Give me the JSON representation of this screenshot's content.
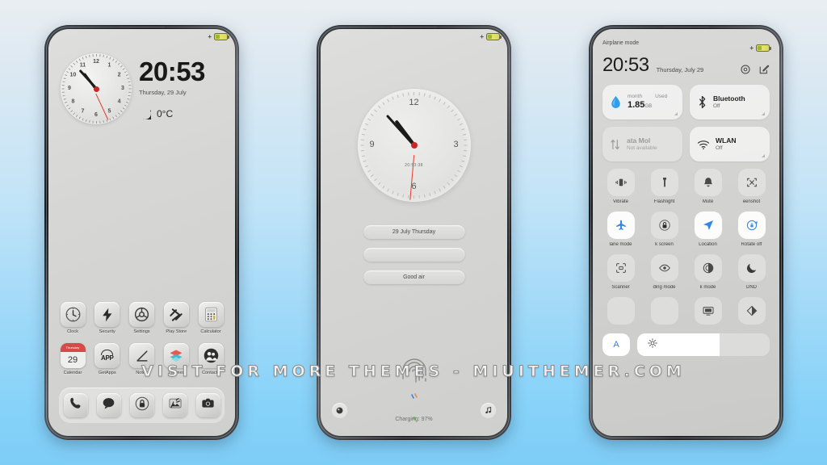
{
  "background": {
    "top_color": "#e9eef1",
    "bottom_color": "#7ecdf7"
  },
  "watermark": {
    "text": "VISIT FOR MORE THEMES - MIUITHEMER.COM"
  },
  "phone1": {
    "name": "home-screen",
    "status": {
      "charging_symbol": "+",
      "battery_color": "#cfe05a"
    },
    "clock_widget": {
      "numbers": [
        "12",
        "1",
        "2",
        "3",
        "4",
        "5",
        "6",
        "7",
        "8",
        "9",
        "10",
        "11"
      ],
      "hour_angle": 323,
      "minute_angle": 318,
      "second_angle": 155,
      "second_hand_color": "#e03b2f"
    },
    "time": "20:53",
    "date": "Thursday, 29 July",
    "weather": {
      "icon": "moon-icon",
      "temperature": "0°C"
    },
    "apps_row1": [
      {
        "label": "Clock",
        "icon": "clock-icon"
      },
      {
        "label": "Security",
        "icon": "bolt-icon"
      },
      {
        "label": "Settings",
        "icon": "settings-gear-icon"
      },
      {
        "label": "Play Store",
        "icon": "play-store-icon"
      },
      {
        "label": "Calculator",
        "icon": "calculator-icon"
      }
    ],
    "apps_row2": [
      {
        "label": "Calendar",
        "icon": "calendar-icon",
        "day": "29",
        "weekday": "Thursday"
      },
      {
        "label": "GetApps",
        "icon": "getapps-icon",
        "text": "APP"
      },
      {
        "label": "Notes",
        "icon": "notes-pencil-icon"
      },
      {
        "label": "Themes",
        "icon": "themes-icon"
      },
      {
        "label": "Contacts",
        "icon": "contacts-icon"
      }
    ],
    "dock": [
      {
        "name": "phone-icon"
      },
      {
        "name": "messages-icon"
      },
      {
        "name": "lock-icon"
      },
      {
        "name": "gallery-icon"
      },
      {
        "name": "camera-icon"
      }
    ]
  },
  "phone2": {
    "name": "lock-screen",
    "status": {
      "charging_symbol": "+"
    },
    "clock": {
      "numbers": [
        "12",
        "3",
        "6",
        "9"
      ],
      "digital_label": "20:53:38",
      "hour_angle": 323,
      "minute_angle": 318,
      "second_angle": 185
    },
    "cards": [
      {
        "text": "29 July Thursday"
      },
      {
        "text": ""
      },
      {
        "text": "Good air"
      }
    ],
    "fingerprint_icon": "fingerprint-icon",
    "charging_text": "Charging: 97%",
    "corner_left_icon": "camera-icon",
    "corner_right_icon": "music-icon"
  },
  "phone3": {
    "name": "control-center",
    "status_label": "Airplane mode",
    "time": "20:53",
    "date": "Thursday, July 29",
    "header_icons": [
      {
        "name": "settings-gear-icon"
      },
      {
        "name": "edit-icon"
      }
    ],
    "big_tiles": [
      {
        "name": "data-usage",
        "label_left": "month",
        "label_right": "Used",
        "value": "1.85",
        "unit": "GB",
        "icon": "water-drop-icon",
        "icon_color": "#2f9de8",
        "state": "active"
      },
      {
        "name": "bluetooth",
        "title": "Bluetooth",
        "subtitle": "Off",
        "icon": "bluetooth-icon",
        "state": "active"
      },
      {
        "name": "mobile-data",
        "title": "ata     Mol",
        "subtitle": "Not available",
        "icon": "data-arrows-icon",
        "state": "disabled"
      },
      {
        "name": "wlan",
        "title": "WLAN",
        "subtitle": "Off",
        "icon": "wifi-icon",
        "state": "active"
      }
    ],
    "tiles": [
      {
        "label": "Vibrate",
        "icon": "vibrate-icon",
        "on": false
      },
      {
        "label": "Flashlight",
        "icon": "flashlight-icon",
        "on": false
      },
      {
        "label": "Mute",
        "icon": "bell-icon",
        "on": false
      },
      {
        "label": "eenshot",
        "icon": "screenshot-icon",
        "on": false
      },
      {
        "label": "lane mode",
        "icon": "airplane-icon",
        "on": true
      },
      {
        "label": "k screen",
        "icon": "lock-icon",
        "on": false
      },
      {
        "label": "Location",
        "icon": "location-icon",
        "on": true
      },
      {
        "label": "Rotate off",
        "icon": "rotate-lock-icon",
        "on": true
      },
      {
        "label": "Scanner",
        "icon": "scanner-icon",
        "on": false
      },
      {
        "label": "ding mode",
        "icon": "eye-icon",
        "on": false
      },
      {
        "label": "k mode",
        "icon": "contrast-icon",
        "on": false
      },
      {
        "label": "DND",
        "icon": "moon-icon",
        "on": false
      }
    ],
    "bottom_tiles": [
      {
        "label": "",
        "icon": "blank-icon",
        "on": false
      },
      {
        "label": "",
        "icon": "blank-icon",
        "on": false
      },
      {
        "label": "",
        "icon": "cast-icon",
        "on": false
      },
      {
        "label": "",
        "icon": "halfmoon-icon",
        "on": false
      }
    ],
    "brightness": {
      "auto_label": "A",
      "icon": "sun-icon",
      "level_percent": 62
    }
  }
}
